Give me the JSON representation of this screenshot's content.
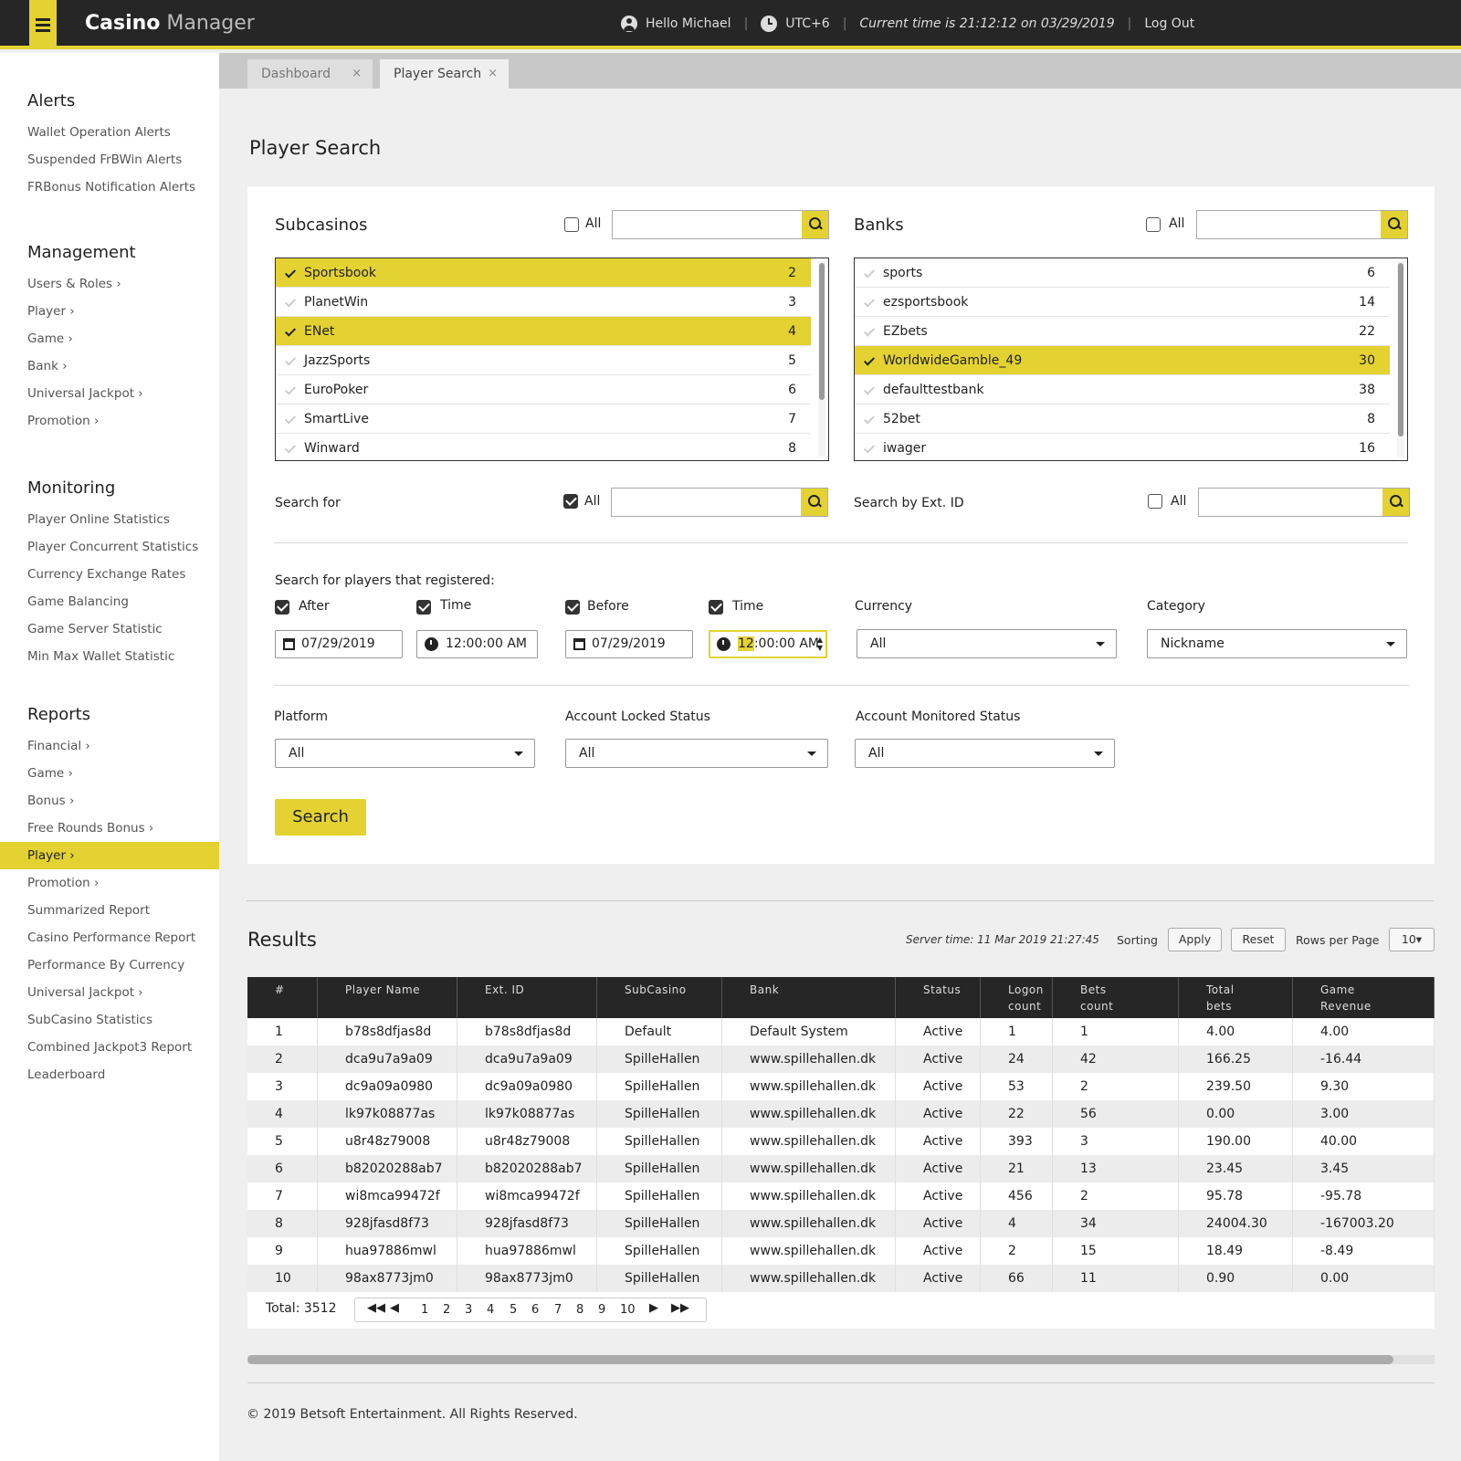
{
  "header": {
    "brand_bold": "Casino",
    "brand_light": "Manager",
    "greeting": "Hello Michael",
    "timezone": "UTC+6",
    "current_time": "Current time is 21:12:12 on 03/29/2019",
    "logout": "Log Out",
    "accent": "#e3d232"
  },
  "sidebar": {
    "alerts": {
      "title": "Alerts",
      "items": [
        "Wallet Operation Alerts",
        "Suspended FrBWin Alerts",
        "FRBonus Notification Alerts"
      ]
    },
    "management": {
      "title": "Management",
      "items": [
        "Users & Roles ›",
        "Player ›",
        "Game ›",
        "Bank ›",
        "Universal Jackpot ›",
        "Promotion ›"
      ]
    },
    "monitoring": {
      "title": "Monitoring",
      "items": [
        "Player Online Statistics",
        "Player Concurrent Statistics",
        "Currency Exchange Rates",
        "Game Balancing",
        "Game Server Statistic",
        "Min Max Wallet Statistic"
      ]
    },
    "reports": {
      "title": "Reports",
      "items": [
        "Financial ›",
        "Game ›",
        "Bonus ›",
        "Free Rounds Bonus ›",
        "Player ›",
        "Promotion ›",
        "Summarized Report",
        "Casino Performance Report",
        "Performance By Currency",
        "Universal Jackpot ›",
        "SubCasino Statistics",
        "Combined Jackpot3 Report",
        "Leaderboard"
      ],
      "active_index": 4
    }
  },
  "tabs": [
    {
      "label": "Dashboard",
      "close": "×",
      "active": false
    },
    {
      "label": "Player Search",
      "close": "×",
      "active": true
    }
  ],
  "page_title": "Player Search",
  "filters": {
    "subcasinos": {
      "title": "Subcasinos",
      "all_label": "All",
      "all_checked": false,
      "search_value": "",
      "items": [
        {
          "name": "Sportsbook",
          "count": "2",
          "selected": true
        },
        {
          "name": "PlanetWin",
          "count": "3",
          "selected": false
        },
        {
          "name": "ENet",
          "count": "4",
          "selected": true
        },
        {
          "name": "JazzSports",
          "count": "5",
          "selected": false
        },
        {
          "name": "EuroPoker",
          "count": "6",
          "selected": false
        },
        {
          "name": "SmartLive",
          "count": "7",
          "selected": false
        },
        {
          "name": "Winward",
          "count": "8",
          "selected": false
        }
      ]
    },
    "banks": {
      "title": "Banks",
      "all_label": "All",
      "all_checked": false,
      "search_value": "",
      "items": [
        {
          "name": "sports",
          "count": "6",
          "selected": false
        },
        {
          "name": "ezsportsbook",
          "count": "14",
          "selected": false
        },
        {
          "name": "EZbets",
          "count": "22",
          "selected": false
        },
        {
          "name": "WorldwideGamble_49",
          "count": "30",
          "selected": true
        },
        {
          "name": "defaulttestbank",
          "count": "38",
          "selected": false
        },
        {
          "name": "52bet",
          "count": "8",
          "selected": false
        },
        {
          "name": "iwager",
          "count": "16",
          "selected": false
        }
      ]
    },
    "search_for": {
      "label": "Search for",
      "all_label": "All",
      "all_checked": true,
      "value": ""
    },
    "search_ext": {
      "label": "Search by Ext. ID",
      "all_label": "All",
      "all_checked": false,
      "value": ""
    },
    "registered_label": "Search for players that registered:",
    "after": {
      "label": "After",
      "checked": true,
      "date": "07/29/2019"
    },
    "after_time": {
      "label": "Time",
      "checked": true,
      "time": "12:00:00 AM"
    },
    "before": {
      "label": "Before",
      "checked": true,
      "date": "07/29/2019"
    },
    "before_time": {
      "label": "Time",
      "checked": true,
      "time_hl": "12",
      "time_rest": ":00:00 AM"
    },
    "currency": {
      "label": "Currency",
      "value": "All"
    },
    "category": {
      "label": "Category",
      "value": "Nickname"
    },
    "platform": {
      "label": "Platform",
      "value": "All"
    },
    "locked": {
      "label": "Account Locked Status",
      "value": "All"
    },
    "monitored": {
      "label": "Account Monitored Status",
      "value": "All"
    },
    "search_button": "Search"
  },
  "results": {
    "title": "Results",
    "server_time": "Server time: 11 Mar 2019 21:27:45",
    "sorting_label": "Sorting",
    "apply": "Apply",
    "reset": "Reset",
    "rows_per_page_label": "Rows per Page",
    "rows_per_page": "10▾",
    "columns": [
      [
        "#",
        ""
      ],
      [
        "Player Name",
        ""
      ],
      [
        "Ext. ID",
        ""
      ],
      [
        "SubCasino",
        ""
      ],
      [
        "Bank",
        ""
      ],
      [
        "Status",
        ""
      ],
      [
        "Logon",
        "count"
      ],
      [
        "Bets",
        "count"
      ],
      [
        "Total",
        "bets"
      ],
      [
        "Game",
        "Revenue"
      ]
    ],
    "rows": [
      [
        "1",
        "b78s8dfjas8d",
        "b78s8dfjas8d",
        "Default",
        "Default System",
        "Active",
        "1",
        "1",
        "4.00",
        "4.00"
      ],
      [
        "2",
        "dca9u7a9a09",
        "dca9u7a9a09",
        "SpilleHallen",
        "www.spillehallen.dk",
        "Active",
        "24",
        "42",
        "166.25",
        "-16.44"
      ],
      [
        "3",
        "dc9a09a0980",
        "dc9a09a0980",
        "SpilleHallen",
        "www.spillehallen.dk",
        "Active",
        "53",
        "2",
        "239.50",
        "9.30"
      ],
      [
        "4",
        "lk97k08877as",
        "lk97k08877as",
        "SpilleHallen",
        "www.spillehallen.dk",
        "Active",
        "22",
        "56",
        "0.00",
        "3.00"
      ],
      [
        "5",
        "u8r48z79008",
        "u8r48z79008",
        "SpilleHallen",
        "www.spillehallen.dk",
        "Active",
        "393",
        "3",
        "190.00",
        "40.00"
      ],
      [
        "6",
        "b82020288ab7",
        "b82020288ab7",
        "SpilleHallen",
        "www.spillehallen.dk",
        "Active",
        "21",
        "13",
        "23.45",
        "3.45"
      ],
      [
        "7",
        "wi8mca99472f",
        "wi8mca99472f",
        "SpilleHallen",
        "www.spillehallen.dk",
        "Active",
        "456",
        "2",
        "95.78",
        "-95.78"
      ],
      [
        "8",
        "928jfasd8f73",
        "928jfasd8f73",
        "SpilleHallen",
        "www.spillehallen.dk",
        "Active",
        "4",
        "34",
        "24004.30",
        "-167003.20"
      ],
      [
        "9",
        "hua97886mwl",
        "hua97886mwl",
        "SpilleHallen",
        "www.spillehallen.dk",
        "Active",
        "2",
        "15",
        "18.49",
        "-8.49"
      ],
      [
        "10",
        "98ax8773jm0",
        "98ax8773jm0",
        "SpilleHallen",
        "www.spillehallen.dk",
        "Active",
        "66",
        "11",
        "0.90",
        "0.00"
      ]
    ],
    "total": "Total: 3512",
    "pages": [
      "1",
      "2",
      "3",
      "4",
      "5",
      "6",
      "7",
      "8",
      "9",
      "10"
    ]
  },
  "footer": {
    "copyright": "© 2019 Betsoft Entertainment. All Rights Reserved."
  }
}
